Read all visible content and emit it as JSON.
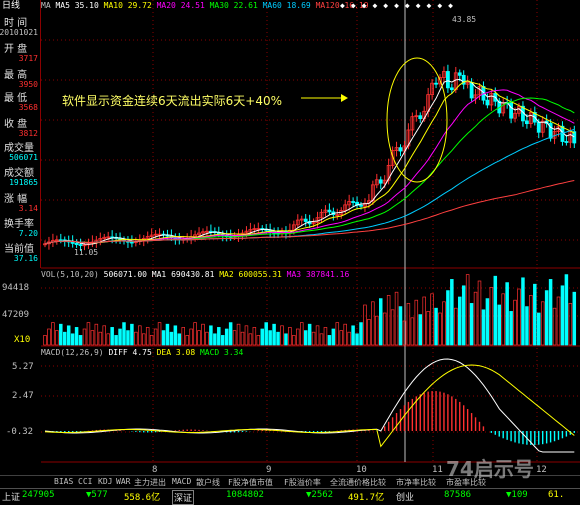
{
  "window_label": "日线",
  "ma_legend": [
    {
      "label": "MA",
      "color": "#c0c0c0"
    },
    {
      "label": "MA5 35.10",
      "color": "#ffffff"
    },
    {
      "label": "MA10 29.72",
      "color": "#ffff00"
    },
    {
      "label": "MA20 24.51",
      "color": "#ff00ff"
    },
    {
      "label": "MA30 22.61",
      "color": "#00ff00"
    },
    {
      "label": "MA60 18.69",
      "color": "#00ccff"
    },
    {
      "label": "MA120 16.19",
      "color": "#ff4040"
    }
  ],
  "left_panel": {
    "time_label": "时 间",
    "date": "20101021",
    "open_label": "开 盘",
    "open": "3717",
    "high_label": "最 高",
    "high": "3950",
    "low_label": "最 低",
    "low": "3568",
    "close_label": "收 盘",
    "close": "3812",
    "volume_label": "成交量",
    "volume": "506071",
    "amount_label": "成交额",
    "amount": "191865",
    "change_label": "涨 幅",
    "change": "3.14",
    "turnover_label": "换手率",
    "turnover": "7.20",
    "current_label": "当前值",
    "current": "37.16"
  },
  "annotation": "软件显示资金连续6天流出实际6天+40%",
  "price_labels": {
    "high_mark": "43.85",
    "low_mark": "11.05"
  },
  "volume_legend": [
    {
      "label": "VOL(5,10,20)",
      "color": "#c0c0c0"
    },
    {
      "label": "506071.00",
      "color": "#ffffff"
    },
    {
      "label": "MA1 690430.81",
      "color": "#ffffff"
    },
    {
      "label": "MA2 600055.31",
      "color": "#ffff00"
    },
    {
      "label": "MA3 387841.16",
      "color": "#ff00ff"
    }
  ],
  "volume_axis": [
    "94418",
    "47209",
    "X10"
  ],
  "macd_legend": [
    {
      "label": "MACD(12,26,9)",
      "color": "#c0c0c0"
    },
    {
      "label": "DIFF 4.75",
      "color": "#ffffff"
    },
    {
      "label": "DEA 3.08",
      "color": "#ffff00"
    },
    {
      "label": "MACD 3.34",
      "color": "#00ff00"
    }
  ],
  "macd_axis": [
    "5.27",
    "2.47",
    "-0.32"
  ],
  "month_labels": [
    "8",
    "9",
    "10",
    "11",
    "12"
  ],
  "tabs": [
    "BIAS",
    "CCI",
    "KDJ",
    "WAR",
    "主力进出",
    "MACD",
    "散户线",
    "F股净值市值",
    "F股溢价率",
    "全流通价格比较",
    "市净率比较",
    "市盈率比较"
  ],
  "status": {
    "index_name": "上证",
    "index_value": "247905",
    "change_1": "▼577",
    "amount_1": "558.6亿",
    "index_name_2": "深证",
    "value_2": "1084802",
    "change_2": "▼2562",
    "amount_2": "491.7亿",
    "index_name_3": "创业",
    "value_3": "87586",
    "change_3": "▼109",
    "amount_3": "61."
  },
  "watermark": "74启示号",
  "colors": {
    "up": "#ff3030",
    "down": "#00ffff",
    "grid": "#8b0000",
    "bg": "#000000"
  }
}
